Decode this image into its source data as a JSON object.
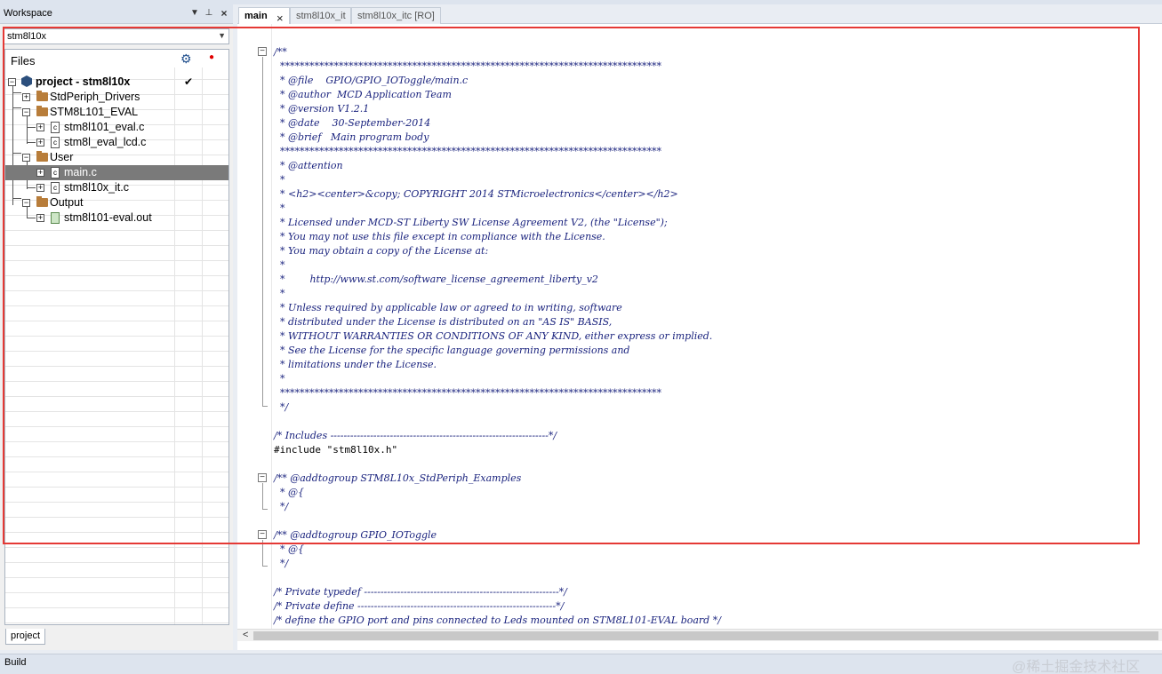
{
  "workspace": {
    "title": "Workspace",
    "dropdown_icon": "▼",
    "pin_icon": "⊥",
    "close_icon": "×",
    "config_selected": "stm8l10x",
    "files_header": "Files",
    "bottom_tab": "project"
  },
  "tree": [
    {
      "label": "project - stm8l10x",
      "type": "project",
      "bold": true,
      "checked": true
    },
    {
      "label": "StdPeriph_Drivers",
      "type": "folder"
    },
    {
      "label": "STM8L101_EVAL",
      "type": "folder"
    },
    {
      "label": "stm8l101_eval.c",
      "type": "file"
    },
    {
      "label": "stm8l_eval_lcd.c",
      "type": "file"
    },
    {
      "label": "User",
      "type": "folder"
    },
    {
      "label": "main.c",
      "type": "file",
      "selected": true
    },
    {
      "label": "stm8l10x_it.c",
      "type": "file"
    },
    {
      "label": "Output",
      "type": "folder"
    },
    {
      "label": "stm8l101-eval.out",
      "type": "output"
    }
  ],
  "editor": {
    "tabs": [
      {
        "label": "main",
        "active": true
      },
      {
        "label": "stm8l10x_it",
        "active": false
      },
      {
        "label": "stm8l10x_itc [RO]",
        "active": false
      }
    ],
    "lines": [
      "/**",
      "  ******************************************************************************",
      "  * @file    GPIO/GPIO_IOToggle/main.c",
      "  * @author  MCD Application Team",
      "  * @version V1.2.1",
      "  * @date    30-September-2014",
      "  * @brief   Main program body",
      "  ******************************************************************************",
      "  * @attention",
      "  *",
      "  * <h2><center>&copy; COPYRIGHT 2014 STMicroelectronics</center></h2>",
      "  *",
      "  * Licensed under MCD-ST Liberty SW License Agreement V2, (the \"License\");",
      "  * You may not use this file except in compliance with the License.",
      "  * You may obtain a copy of the License at:",
      "  *",
      "  *        http://www.st.com/software_license_agreement_liberty_v2",
      "  *",
      "  * Unless required by applicable law or agreed to in writing, software",
      "  * distributed under the License is distributed on an \"AS IS\" BASIS,",
      "  * WITHOUT WARRANTIES OR CONDITIONS OF ANY KIND, either express or implied.",
      "  * See the License for the specific language governing permissions and",
      "  * limitations under the License.",
      "  *",
      "  ******************************************************************************",
      "  */",
      "",
      "/* Includes ------------------------------------------------------------------*/",
      "#include \"stm8l10x.h\"",
      "",
      "/** @addtogroup STM8L10x_StdPeriph_Examples",
      "  * @{",
      "  */",
      "",
      "/** @addtogroup GPIO_IOToggle",
      "  * @{",
      "  */",
      "",
      "/* Private typedef -----------------------------------------------------------*/",
      "/* Private define ------------------------------------------------------------*/",
      "/* define the GPIO port and pins connected to Leds mounted on STM8L101-EVAL board */"
    ],
    "fold_open": "−"
  },
  "build_bar": {
    "title": "Build",
    "watermark": "@稀土掘金技术社区"
  },
  "colors": {
    "comment": "#1a237e",
    "highlight": "#e53935",
    "folder": "#b87d3a",
    "selected_row": "#7a7a7a"
  },
  "icons": {
    "gear": "gear-icon",
    "record": "red-dot-icon",
    "check": "✔"
  }
}
